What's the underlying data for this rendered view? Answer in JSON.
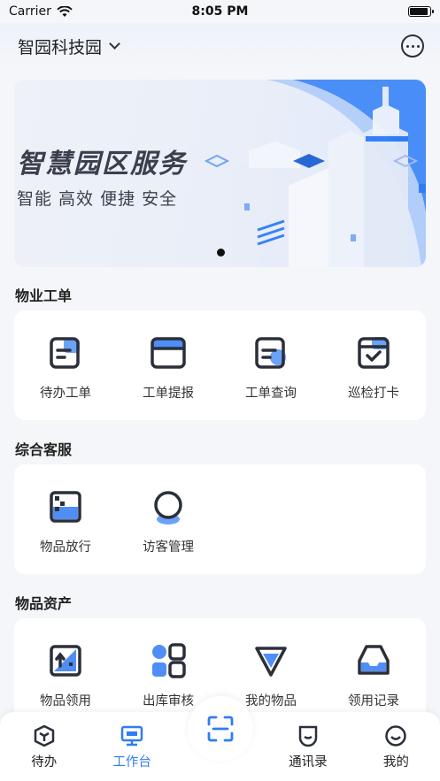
{
  "status_bar": {
    "carrier": "Carrier",
    "time": "8:05 PM"
  },
  "header": {
    "park_name": "智园科技园"
  },
  "banner": {
    "title": "智慧园区服务",
    "subtitle": "智能 高效 便捷 安全"
  },
  "sections": [
    {
      "title": "物业工单",
      "items": [
        {
          "label": "待办工单",
          "icon": "todo-ticket-icon"
        },
        {
          "label": "工单提报",
          "icon": "submit-ticket-icon"
        },
        {
          "label": "工单查询",
          "icon": "query-ticket-icon"
        },
        {
          "label": "巡检打卡",
          "icon": "inspection-checkin-icon"
        }
      ]
    },
    {
      "title": "综合客服",
      "items": [
        {
          "label": "物品放行",
          "icon": "item-release-icon"
        },
        {
          "label": "访客管理",
          "icon": "visitor-management-icon"
        }
      ]
    },
    {
      "title": "物品资产",
      "items": [
        {
          "label": "物品领用",
          "icon": "item-requisition-icon"
        },
        {
          "label": "出库审核",
          "icon": "outbound-review-icon"
        },
        {
          "label": "我的物品",
          "icon": "my-items-icon"
        },
        {
          "label": "领用记录",
          "icon": "requisition-record-icon"
        }
      ]
    }
  ],
  "tabbar": {
    "items": [
      {
        "label": "待办",
        "icon": "todo-tab-icon"
      },
      {
        "label": "工作台",
        "icon": "workbench-tab-icon",
        "active": true
      },
      {
        "label": "",
        "icon": "scan-icon"
      },
      {
        "label": "通讯录",
        "icon": "contacts-tab-icon"
      },
      {
        "label": "我的",
        "icon": "profile-tab-icon"
      }
    ]
  },
  "colors": {
    "accent": "#2f7cf6",
    "icon_dark": "#2b2f3a"
  }
}
